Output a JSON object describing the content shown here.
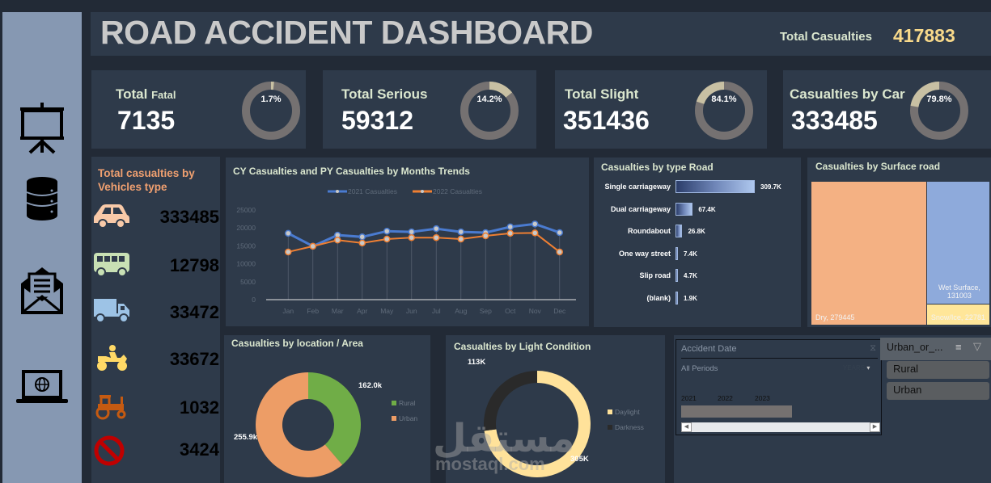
{
  "header": {
    "title": "ROAD ACCIDENT DASHBOARD",
    "total_label": "Total Casualties",
    "total_value": "417883"
  },
  "sidebar": {
    "items": [
      {
        "icon": "presentation-board-icon"
      },
      {
        "icon": "database-icon"
      },
      {
        "icon": "mail-open-icon"
      },
      {
        "icon": "laptop-globe-icon"
      }
    ]
  },
  "kpis": [
    {
      "label_main": "Total",
      "label_sub": "Fatal",
      "value": "7135",
      "percent_text": "1.7%",
      "percent": 1.7
    },
    {
      "label_main": "Total Serious",
      "label_sub": "",
      "value": "59312",
      "percent_text": "14.2%",
      "percent": 14.2
    },
    {
      "label_main": "Total Slight",
      "label_sub": "",
      "value": "351436",
      "percent_text": "84.1%",
      "percent": 84.1
    },
    {
      "label_main": "Casualties by Car",
      "label_sub": "",
      "value": "333485",
      "percent_text": "79.8%",
      "percent": 79.8
    }
  ],
  "vehicles": {
    "title": "Total casualties by Vehicles type",
    "items": [
      {
        "icon": "car-icon",
        "value": "333485",
        "color": "#f2a77a"
      },
      {
        "icon": "bus-icon",
        "value": "12798",
        "color": "#a6cf8a"
      },
      {
        "icon": "truck-icon",
        "value": "33472",
        "color": "#bcd3f0"
      },
      {
        "icon": "motorcycle-icon",
        "value": "33672",
        "color": "#c39613"
      },
      {
        "icon": "tractor-icon",
        "value": "1032",
        "color": "#8a3a1c"
      },
      {
        "icon": "prohibited-icon",
        "value": "3424",
        "color": "#ff1a1a"
      }
    ]
  },
  "chart_data": [
    {
      "type": "line",
      "title": "CY Casualties and PY Casualties by Months Trends",
      "categories": [
        "Jan",
        "Feb",
        "Mar",
        "Apr",
        "May",
        "Jun",
        "Jul",
        "Aug",
        "Sep",
        "Oct",
        "Nov",
        "Dec"
      ],
      "series": [
        {
          "name": "2021 Casualties",
          "color": "#4a7bd0",
          "values": [
            18500,
            14900,
            18000,
            17500,
            19100,
            18900,
            19800,
            18900,
            18700,
            20300,
            21100,
            18700
          ]
        },
        {
          "name": "2022 Casualties",
          "color": "#ef7f32",
          "values": [
            13300,
            14900,
            16600,
            15800,
            16900,
            17300,
            17300,
            16900,
            17800,
            18500,
            18600,
            13300
          ]
        }
      ],
      "yticks": [
        "0",
        "5000",
        "10000",
        "15000",
        "20000",
        "25000"
      ],
      "ylim": [
        0,
        25000
      ],
      "legend": "top",
      "grid": false
    },
    {
      "type": "bar",
      "title": "Casualties by type  Road",
      "categories": [
        "Single carriageway",
        "Dual carriageway",
        "Roundabout",
        "One way street",
        "Slip road",
        "(blank)"
      ],
      "values": [
        309700,
        67400,
        26800,
        7400,
        4700,
        1900
      ],
      "labels": [
        "309.7K",
        "67.4K",
        "26.8K",
        "7.4K",
        "4.7K",
        "1.9K"
      ],
      "orientation": "horizontal"
    },
    {
      "type": "treemap",
      "title": "Casualties by Surface road",
      "items": [
        {
          "label": "Dry",
          "value": 279445,
          "color": "#f4b183"
        },
        {
          "label": "Wet Surface",
          "value": 131003,
          "color": "#8eaadb"
        },
        {
          "label": "Snow/Ice",
          "value": 22781,
          "color": "#ffe699"
        }
      ]
    },
    {
      "type": "pie",
      "title": "Casualties by location / Area",
      "donut": true,
      "items": [
        {
          "label": "Rural",
          "value": 162000,
          "value_text": "162.0k",
          "color": "#70ad47"
        },
        {
          "label": "Urban",
          "value": 255900,
          "value_text": "255.9k",
          "color": "#ed9d66"
        }
      ],
      "legend": "right"
    },
    {
      "type": "pie",
      "title": "Casualties by Light Condition",
      "donut": true,
      "items": [
        {
          "label": "Daylight",
          "value": 305000,
          "value_text": "305K",
          "color": "#ffe29a"
        },
        {
          "label": "Darkness",
          "value": 113000,
          "value_text": "113K",
          "color": "#2a2a2a"
        }
      ],
      "legend": "right"
    }
  ],
  "timeline_slicer": {
    "title": "Accident Date",
    "period": "All Periods",
    "level": "YEARS",
    "years": [
      "2021",
      "2022",
      "2023"
    ]
  },
  "category_slicer": {
    "title": "Urban_or_...",
    "options": [
      "Rural",
      "Urban"
    ]
  },
  "watermark": {
    "arabic": "مستقل",
    "latin": "mostaql.com"
  }
}
